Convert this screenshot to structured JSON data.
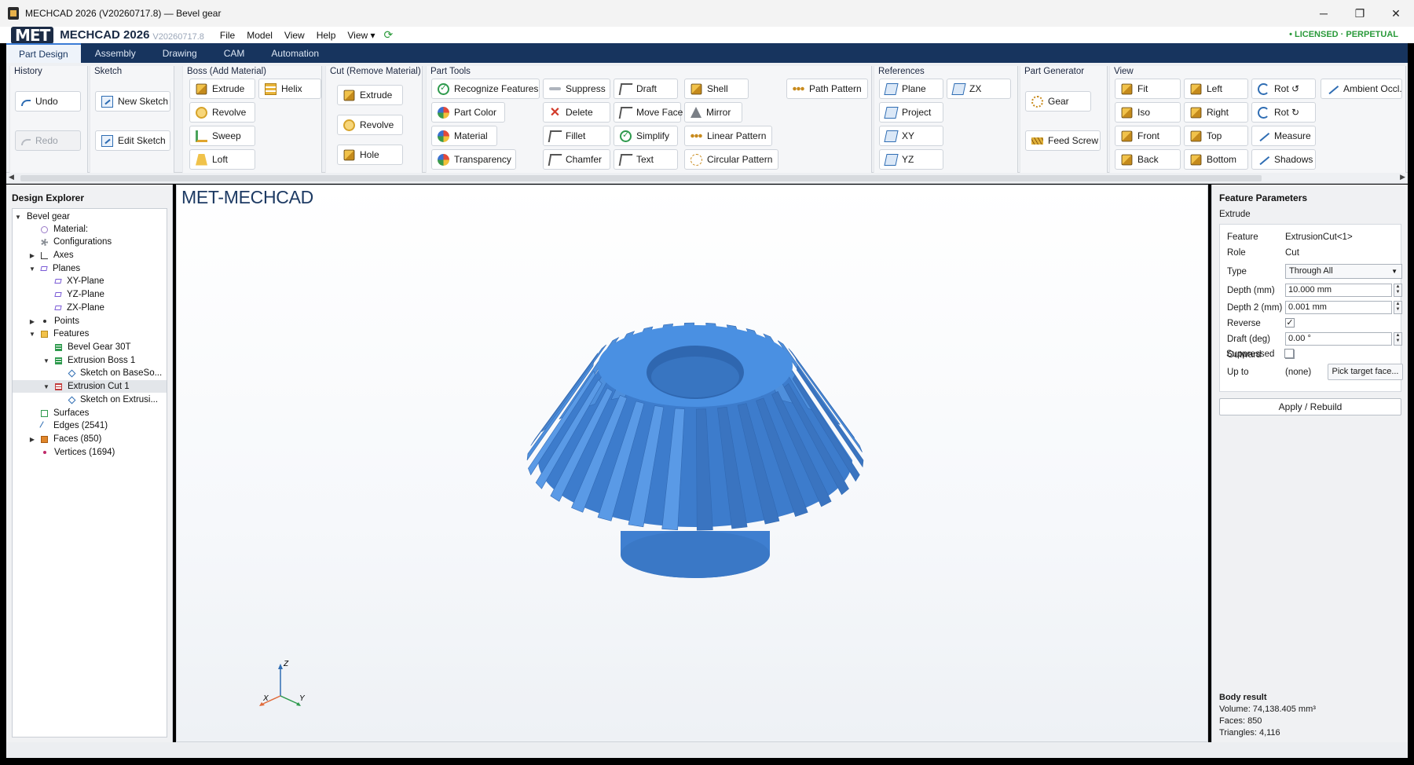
{
  "window": {
    "title": "MECHCAD 2026 (V20260717.8) — Bevel gear",
    "controls": [
      "─",
      "❐",
      "✕"
    ]
  },
  "menubar": {
    "logo_text": "MET",
    "brand": "MECHCAD 2026",
    "version": "V20260717.8",
    "menus": [
      "File",
      "Model",
      "View",
      "Help",
      "View ▾"
    ],
    "license": "• LICENSED · PERPETUAL"
  },
  "tabs": [
    "Part Design",
    "Assembly",
    "Drawing",
    "CAM",
    "Automation"
  ],
  "ribbon": {
    "history": {
      "title": "History",
      "undo": "Undo",
      "redo": "Redo"
    },
    "sketch": {
      "title": "Sketch",
      "new": "New Sketch",
      "edit": "Edit Sketch"
    },
    "boss": {
      "title": "Boss (Add Material)",
      "extrude": "Extrude",
      "helix": "Helix",
      "revolve": "Revolve",
      "sweep": "Sweep",
      "loft": "Loft"
    },
    "cut": {
      "title": "Cut (Remove Material)",
      "extrude": "Extrude",
      "revolve": "Revolve",
      "hole": "Hole"
    },
    "parttools": {
      "title": "Part Tools",
      "recognize": "Recognize Features",
      "part_color": "Part Color",
      "material": "Material",
      "transparency": "Transparency",
      "suppress": "Suppress",
      "delete": "Delete",
      "fillet": "Fillet",
      "chamfer": "Chamfer",
      "draft": "Draft",
      "move_face": "Move Face",
      "simplify": "Simplify",
      "text": "Text",
      "shell": "Shell",
      "mirror": "Mirror",
      "linear_pattern": "Linear Pattern",
      "circular_pattern": "Circular Pattern",
      "path_pattern": "Path Pattern"
    },
    "references": {
      "title": "References",
      "plane": "Plane",
      "zx": "ZX",
      "project": "Project",
      "xy": "XY",
      "yz": "YZ"
    },
    "partgen": {
      "title": "Part Generator",
      "gear": "Gear",
      "feed_screw": "Feed Screw"
    },
    "view": {
      "title": "View",
      "fit": "Fit",
      "iso": "Iso",
      "front": "Front",
      "back": "Back",
      "left": "Left",
      "right": "Right",
      "top": "Top",
      "bottom": "Bottom",
      "rot_ccw": "Rot ↺",
      "rot_cw": "Rot ↻",
      "measure": "Measure",
      "shadows": "Shadows",
      "ambient": "Ambient Occl."
    }
  },
  "explorer": {
    "title": "Design Explorer",
    "nodes": [
      {
        "label": "Bevel gear"
      },
      {
        "label": "Material:"
      },
      {
        "label": "Configurations"
      },
      {
        "label": "Axes"
      },
      {
        "label": "Planes"
      },
      {
        "label": "XY-Plane"
      },
      {
        "label": "YZ-Plane"
      },
      {
        "label": "ZX-Plane"
      },
      {
        "label": "Points"
      },
      {
        "label": "Features"
      },
      {
        "label": "Bevel Gear 30T"
      },
      {
        "label": "Extrusion Boss 1"
      },
      {
        "label": "Sketch on BaseSo..."
      },
      {
        "label": "Extrusion Cut 1"
      },
      {
        "label": "Sketch on Extrusi..."
      },
      {
        "label": "Surfaces"
      },
      {
        "label": "Edges (2541)"
      },
      {
        "label": "Faces (850)"
      },
      {
        "label": "Vertices (1694)"
      }
    ]
  },
  "viewport": {
    "title": "MET-MECHCAD",
    "axes": {
      "x": "X",
      "y": "Y",
      "z": "Z"
    },
    "model_color": "#4a90e2",
    "tooth_count": 30
  },
  "params": {
    "title": "Feature Parameters",
    "subtitle": "Extrude",
    "feature_label": "Feature",
    "feature_value": "ExtrusionCut<1>",
    "role_label": "Role",
    "role_value": "Cut",
    "type_label": "Type",
    "type_value": "Through All",
    "depth_label": "Depth (mm)",
    "depth_value": "10.000 mm",
    "depth2_label": "Depth 2 (mm)",
    "depth2_value": "0.001 mm",
    "reverse_label": "Reverse",
    "reverse_checked": "✓",
    "draft_label": "Draft (deg)",
    "draft_value": "0.00 °",
    "outward_label": "Outward",
    "upto_label": "Up to",
    "upto_value": "(none)",
    "pick_button": "Pick target face...",
    "suppressed_label": "Suppressed",
    "apply": "Apply / Rebuild"
  },
  "body_result": {
    "title": "Body result",
    "volume": "Volume: 74,138.405 mm³",
    "faces": "Faces: 850",
    "triangles": "Triangles: 4,116"
  }
}
